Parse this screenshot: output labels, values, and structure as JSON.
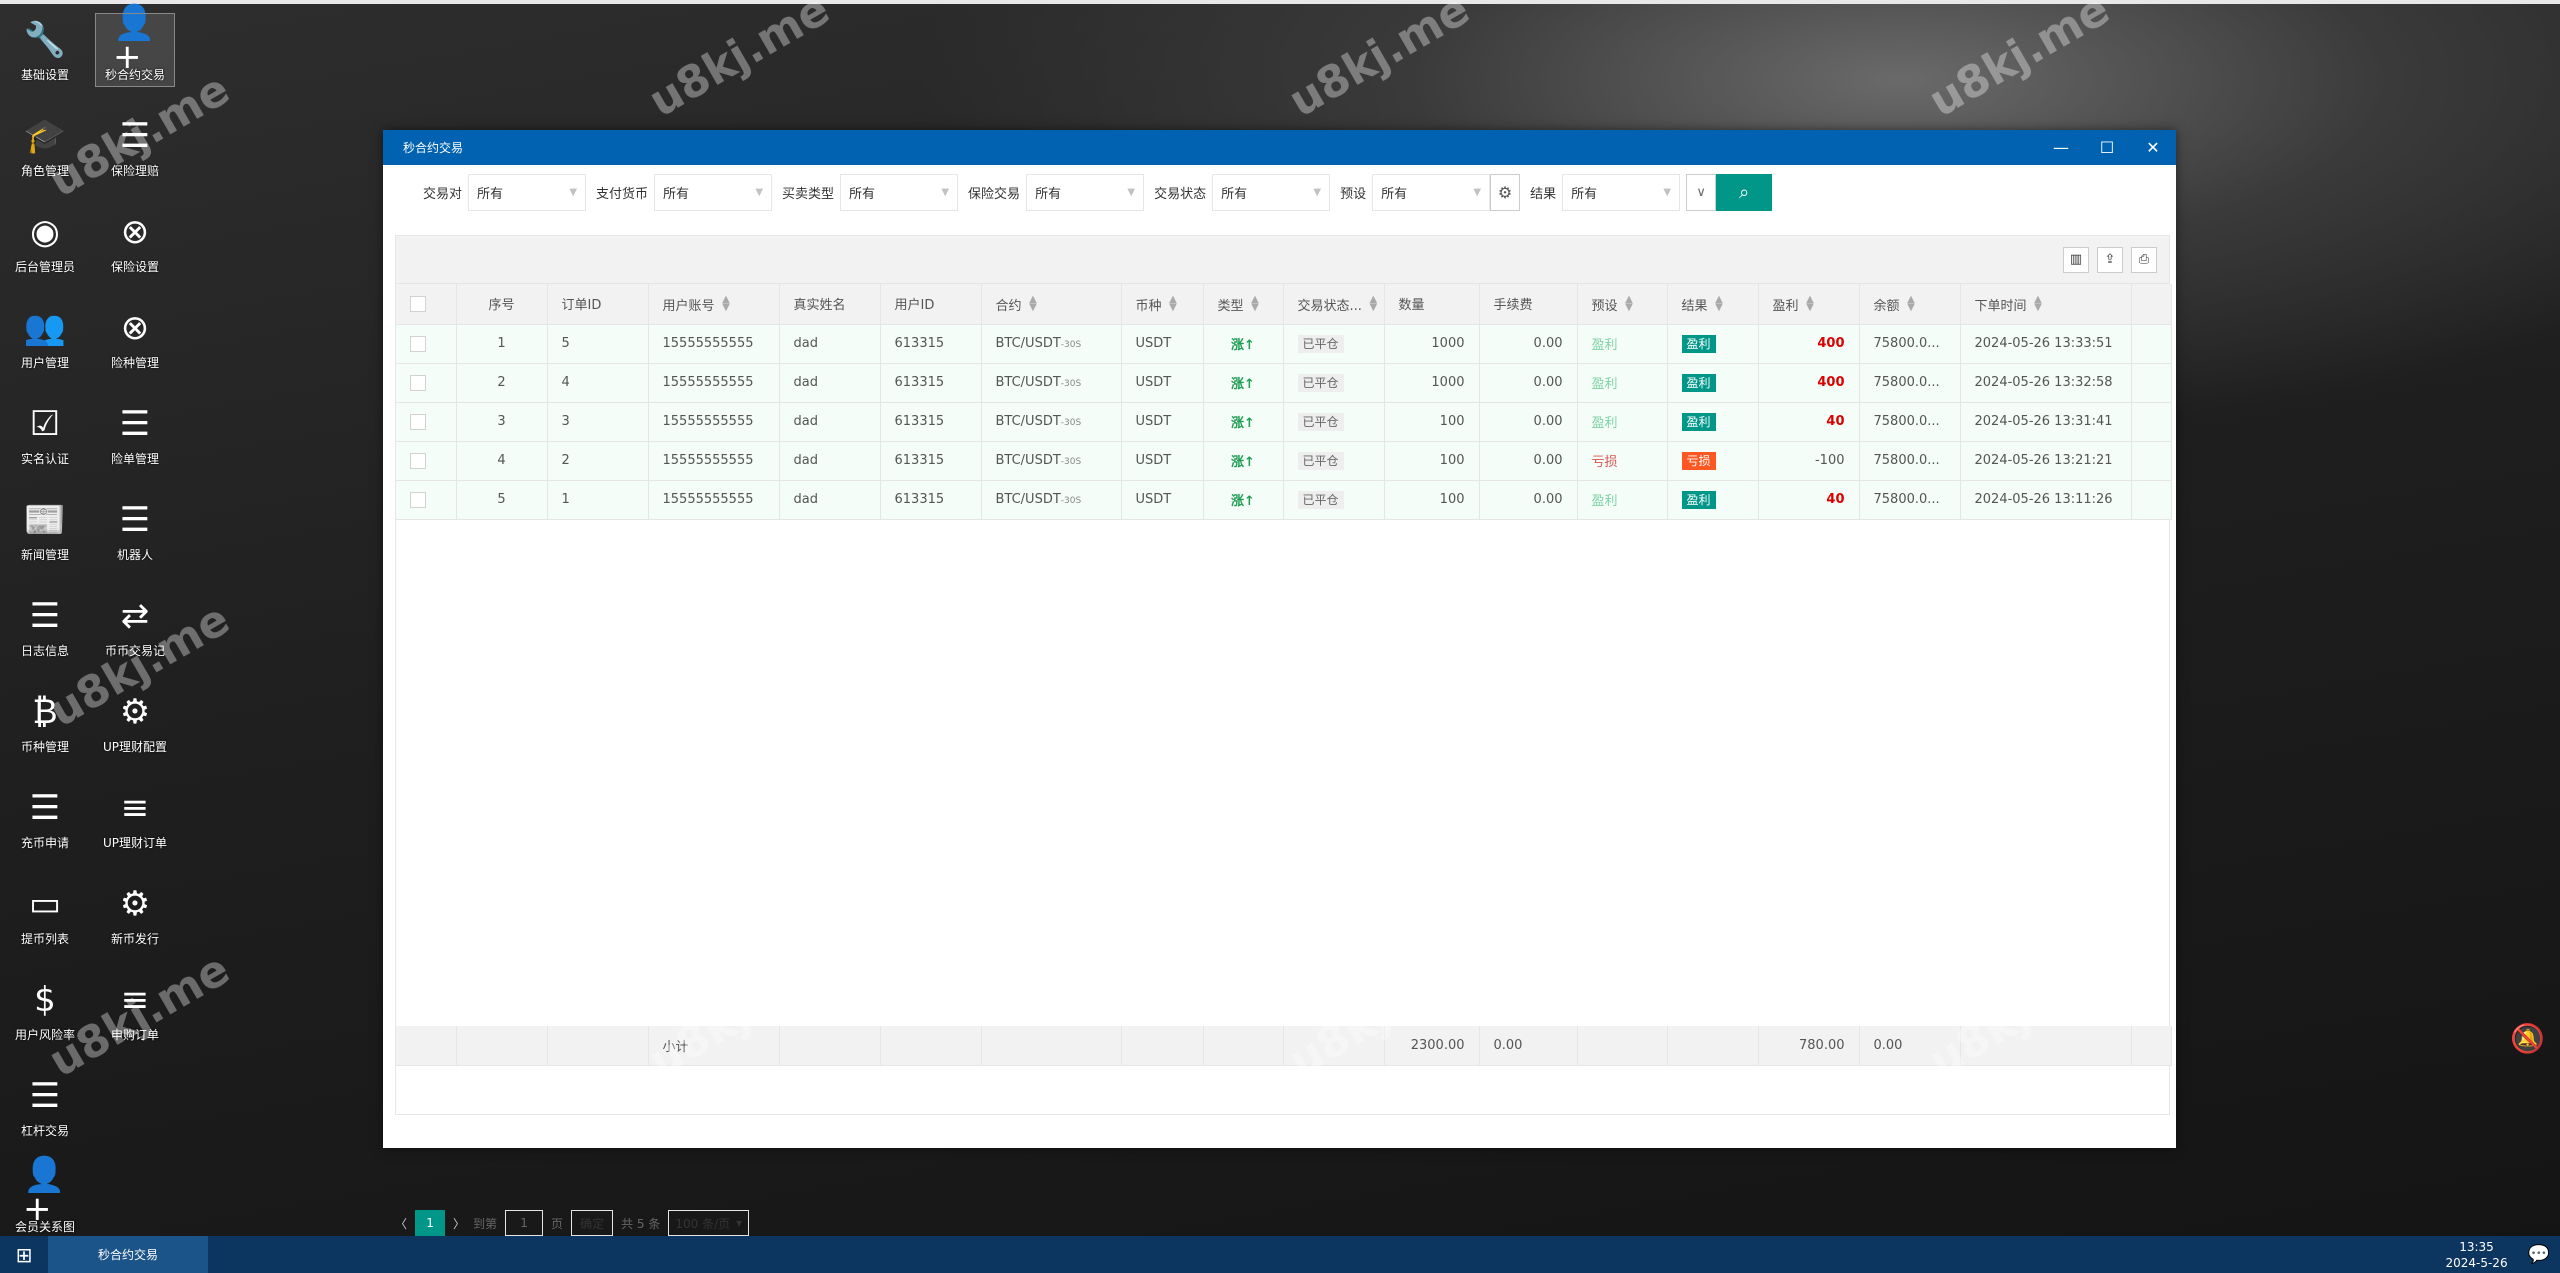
{
  "watermark": "u8kj.me",
  "sidebar": {
    "items": [
      {
        "label": "基础设置",
        "icon": "wrench-icon",
        "glyph": "🔧"
      },
      {
        "label": "秒合约交易",
        "icon": "user-add-icon",
        "glyph": "👤+",
        "active": true
      },
      {
        "label": "角色管理",
        "icon": "graduation-cap-icon",
        "glyph": "🎓"
      },
      {
        "label": "保险理赔",
        "icon": "list-icon",
        "glyph": "☰"
      },
      {
        "label": "后台管理员",
        "icon": "user-circle-icon",
        "glyph": "◉"
      },
      {
        "label": "保险设置",
        "icon": "link-circle-icon",
        "glyph": "⊗"
      },
      {
        "label": "用户管理",
        "icon": "users-icon",
        "glyph": "👥"
      },
      {
        "label": "险种管理",
        "icon": "link-circle-icon",
        "glyph": "⊗"
      },
      {
        "label": "实名认证",
        "icon": "check-square-icon",
        "glyph": "☑"
      },
      {
        "label": "险单管理",
        "icon": "list-icon",
        "glyph": "☰"
      },
      {
        "label": "新闻管理",
        "icon": "newspaper-icon",
        "glyph": "📰"
      },
      {
        "label": "机器人",
        "icon": "list-icon",
        "glyph": "☰"
      },
      {
        "label": "日志信息",
        "icon": "list-icon",
        "glyph": "☰"
      },
      {
        "label": "币币交易记",
        "icon": "exchange-icon",
        "glyph": "⇄"
      },
      {
        "label": "币种管理",
        "icon": "bitcoin-icon",
        "glyph": "₿"
      },
      {
        "label": "UP理财配置",
        "icon": "gears-icon",
        "glyph": "⚙"
      },
      {
        "label": "充币申请",
        "icon": "list-icon",
        "glyph": "☰"
      },
      {
        "label": "UP理财订单",
        "icon": "bars-icon",
        "glyph": "≡"
      },
      {
        "label": "提币列表",
        "icon": "credit-card-icon",
        "glyph": "▭"
      },
      {
        "label": "新币发行",
        "icon": "gear-icon",
        "glyph": "⚙"
      },
      {
        "label": "用户风险率",
        "icon": "dollar-icon",
        "glyph": "$"
      },
      {
        "label": "申购订单",
        "icon": "bars-icon",
        "glyph": "≡"
      },
      {
        "label": "杠杆交易",
        "icon": "list-icon",
        "glyph": "☰"
      },
      {
        "label": "",
        "icon": "",
        "glyph": ""
      },
      {
        "label": "会员关系图",
        "icon": "user-add-icon",
        "glyph": "👤+"
      }
    ]
  },
  "dialog": {
    "title": "秒合约交易",
    "minimize": "—",
    "maximize": "☐",
    "close": "✕"
  },
  "filters": [
    {
      "label": "交易对",
      "value": "所有"
    },
    {
      "label": "支付货币",
      "value": "所有"
    },
    {
      "label": "买卖类型",
      "value": "所有"
    },
    {
      "label": "保险交易",
      "value": "所有"
    },
    {
      "label": "交易状态",
      "value": "所有"
    },
    {
      "label": "预设",
      "value": "所有"
    },
    {
      "label": "结果",
      "value": "所有"
    }
  ],
  "table": {
    "columns": [
      "序号",
      "订单ID",
      "用户账号",
      "真实姓名",
      "用户ID",
      "合约",
      "币种",
      "类型",
      "交易状态...",
      "数量",
      "手续费",
      "预设",
      "结果",
      "盈利",
      "余额",
      "下单时间"
    ],
    "sortable": [
      false,
      false,
      true,
      false,
      false,
      true,
      true,
      true,
      true,
      false,
      false,
      true,
      true,
      true,
      true,
      true
    ],
    "rows": [
      {
        "no": "1",
        "order_id": "5",
        "account": "15555555555",
        "name": "dad",
        "user_id": "613315",
        "contract": "BTC/USDT",
        "period": "-30S",
        "coin": "USDT",
        "type": "涨↑",
        "status": "已平仓",
        "qty": "1000",
        "fee": "0.00",
        "preset": "盈利",
        "result": "盈利",
        "profit": "400",
        "balance": "75800.0...",
        "time": "2024-05-26 13:33:51"
      },
      {
        "no": "2",
        "order_id": "4",
        "account": "15555555555",
        "name": "dad",
        "user_id": "613315",
        "contract": "BTC/USDT",
        "period": "-30S",
        "coin": "USDT",
        "type": "涨↑",
        "status": "已平仓",
        "qty": "1000",
        "fee": "0.00",
        "preset": "盈利",
        "result": "盈利",
        "profit": "400",
        "balance": "75800.0...",
        "time": "2024-05-26 13:32:58"
      },
      {
        "no": "3",
        "order_id": "3",
        "account": "15555555555",
        "name": "dad",
        "user_id": "613315",
        "contract": "BTC/USDT",
        "period": "-30S",
        "coin": "USDT",
        "type": "涨↑",
        "status": "已平仓",
        "qty": "100",
        "fee": "0.00",
        "preset": "盈利",
        "result": "盈利",
        "profit": "40",
        "balance": "75800.0...",
        "time": "2024-05-26 13:31:41"
      },
      {
        "no": "4",
        "order_id": "2",
        "account": "15555555555",
        "name": "dad",
        "user_id": "613315",
        "contract": "BTC/USDT",
        "period": "-30S",
        "coin": "USDT",
        "type": "涨↑",
        "status": "已平仓",
        "qty": "100",
        "fee": "0.00",
        "preset": "亏损",
        "result": "亏损",
        "profit": "-100",
        "balance": "75800.0...",
        "time": "2024-05-26 13:21:21"
      },
      {
        "no": "5",
        "order_id": "1",
        "account": "15555555555",
        "name": "dad",
        "user_id": "613315",
        "contract": "BTC/USDT",
        "period": "-30S",
        "coin": "USDT",
        "type": "涨↑",
        "status": "已平仓",
        "qty": "100",
        "fee": "0.00",
        "preset": "盈利",
        "result": "盈利",
        "profit": "40",
        "balance": "75800.0...",
        "time": "2024-05-26 13:11:26"
      }
    ],
    "subtotal": {
      "label": "小计",
      "qty": "2300.00",
      "fee": "0.00",
      "profit": "780.00",
      "balance": "0.00"
    }
  },
  "pager": {
    "prev": "〈",
    "current": "1",
    "next": "〉",
    "goto_label": "到第",
    "goto_value": "1",
    "page_label": "页",
    "confirm": "确定",
    "total": "共 5 条",
    "page_size": "100 条/页"
  },
  "taskbar": {
    "task": "秒合约交易",
    "time": "13:35",
    "date": "2024-5-26"
  },
  "colors": {
    "titlebar": "#0062b0",
    "primary": "#009688",
    "loss": "#ff5722",
    "profit_text": "#dd0000",
    "taskbar": "#0c3560"
  }
}
